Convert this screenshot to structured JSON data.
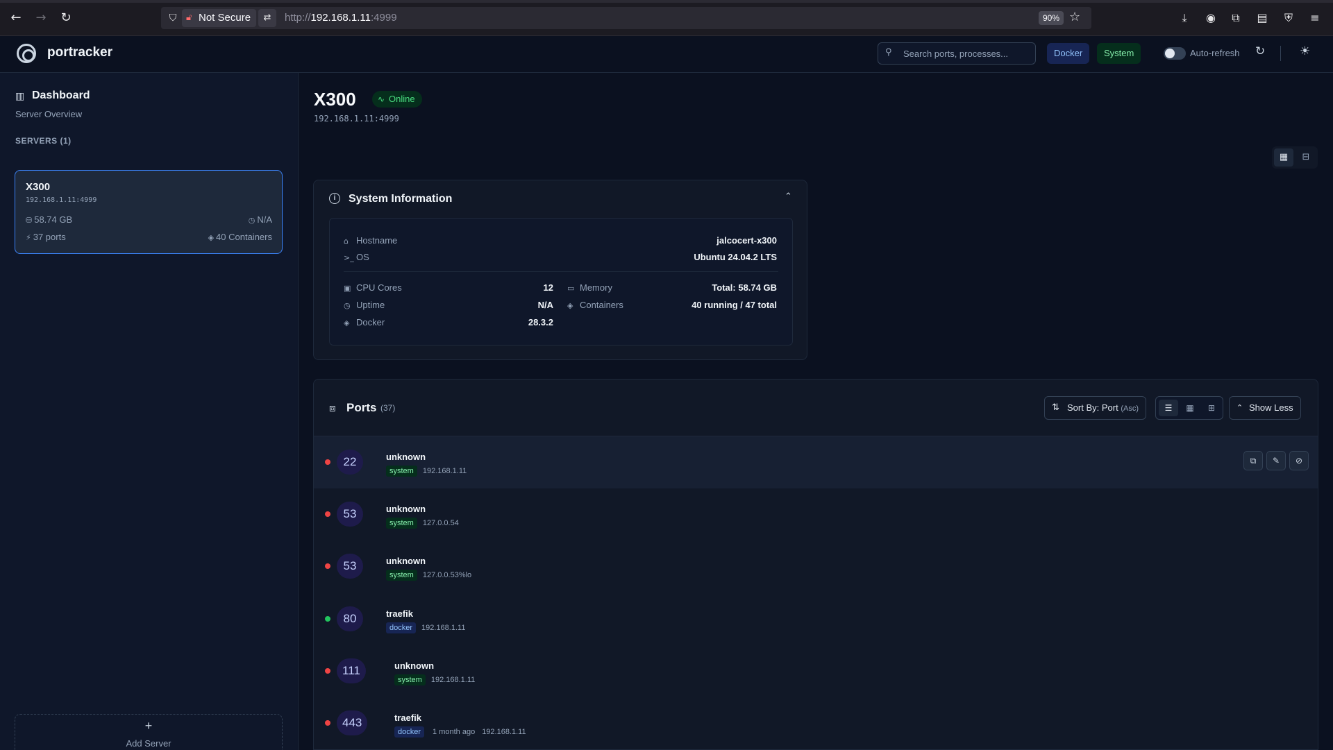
{
  "browser": {
    "security_label": "Not Secure",
    "url_prefix": "http://",
    "url_host": "192.168.1.11",
    "url_port": ":4999",
    "zoom": "90%"
  },
  "header": {
    "brand": "portracker",
    "search_placeholder": "Search ports, processes...",
    "filter_docker": "Docker",
    "filter_system": "System",
    "auto_refresh_label": "Auto-refresh",
    "auto_refresh_on": false
  },
  "sidebar": {
    "title": "Dashboard",
    "subtitle": "Server Overview",
    "servers_heading": "SERVERS (1)",
    "server": {
      "name": "X300",
      "address": "192.168.1.11:4999",
      "memory": "58.74 GB",
      "uptime": "N/A",
      "ports": "37 ports",
      "containers": "40 Containers"
    },
    "add_server_label": "Add Server"
  },
  "main": {
    "server_name": "X300",
    "status": "Online",
    "address": "192.168.1.11:4999"
  },
  "system_info": {
    "title": "System Information",
    "hostname_label": "Hostname",
    "hostname": "jalcocert-x300",
    "os_label": "OS",
    "os": "Ubuntu 24.04.2 LTS",
    "cpu_label": "CPU Cores",
    "cpu": "12",
    "uptime_label": "Uptime",
    "uptime": "N/A",
    "docker_label": "Docker",
    "docker": "28.3.2",
    "memory_label": "Memory",
    "memory": "Total: 58.74 GB",
    "containers_label": "Containers",
    "containers": "40 running / 47 total"
  },
  "ports": {
    "title": "Ports",
    "count": "(37)",
    "sort_label": "Sort By: Port",
    "sort_dir": "(Asc)",
    "show_less_label": "Show Less",
    "rows": [
      {
        "port": "22",
        "name": "unknown",
        "source": "system",
        "age": "",
        "ip": "192.168.1.11",
        "status": "red"
      },
      {
        "port": "53",
        "name": "unknown",
        "source": "system",
        "age": "",
        "ip": "127.0.0.54",
        "status": "red"
      },
      {
        "port": "53",
        "name": "unknown",
        "source": "system",
        "age": "",
        "ip": "127.0.0.53%lo",
        "status": "red"
      },
      {
        "port": "80",
        "name": "traefik",
        "source": "docker",
        "age": "",
        "ip": "192.168.1.11",
        "status": "green"
      },
      {
        "port": "111",
        "name": "unknown",
        "source": "system",
        "age": "",
        "ip": "192.168.1.11",
        "status": "red"
      },
      {
        "port": "443",
        "name": "traefik",
        "source": "docker",
        "age": "1 month ago",
        "ip": "192.168.1.11",
        "status": "red"
      }
    ]
  }
}
